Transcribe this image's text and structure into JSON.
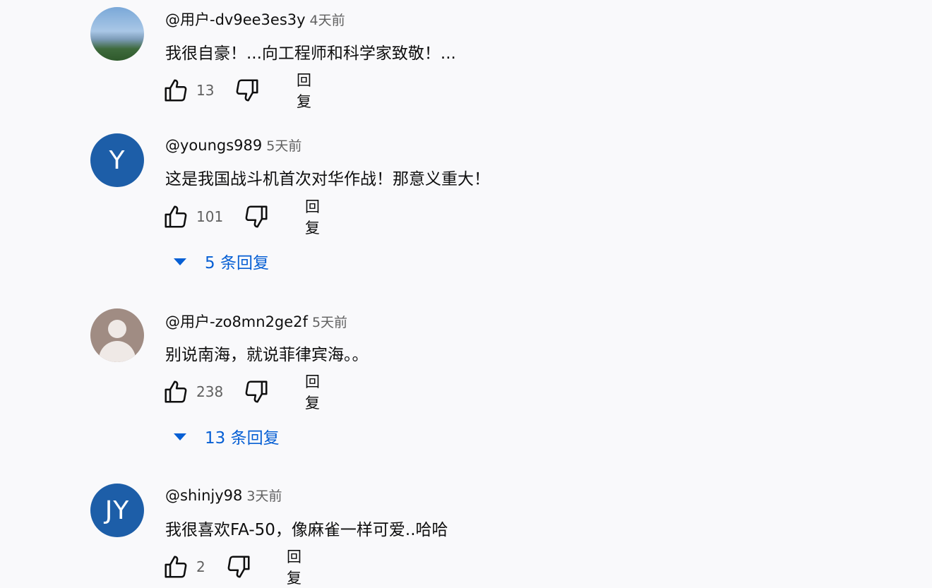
{
  "comments": [
    {
      "user": "@用户-dv9ee3es3y",
      "time": "4天前",
      "text": "我很自豪！...向工程师和科学家致敬！...",
      "likes": "13",
      "reply_label": "回复",
      "avatar": {
        "kind": "photo",
        "initials": ""
      }
    },
    {
      "user": "@youngs989",
      "time": "5天前",
      "text": "这是我国战斗机首次对华作战！那意义重大！",
      "likes": "101",
      "reply_label": "回复",
      "avatar": {
        "kind": "initials",
        "initials": "Y"
      },
      "replies_toggle": "5 条回复"
    },
    {
      "user": "@用户-zo8mn2ge2f",
      "time": "5天前",
      "text": "别说南海，就说菲律宾海。。",
      "likes": "238",
      "reply_label": "回复",
      "avatar": {
        "kind": "default",
        "initials": ""
      },
      "replies_toggle": "13 条回复"
    },
    {
      "user": "@shinjy98",
      "time": "3天前",
      "text": "我很喜欢FA-50，像麻雀一样可爱..哈哈",
      "likes": "2",
      "reply_label": "回复",
      "avatar": {
        "kind": "initials",
        "initials": "JY"
      }
    }
  ],
  "colors": {
    "background": "#f9f9fb",
    "avatar_blue": "#1d5ea8",
    "link_blue": "#065fd4",
    "secondary_text": "#606060"
  },
  "icons": [
    "thumb-up-icon",
    "thumb-down-icon",
    "caret-down-icon"
  ]
}
